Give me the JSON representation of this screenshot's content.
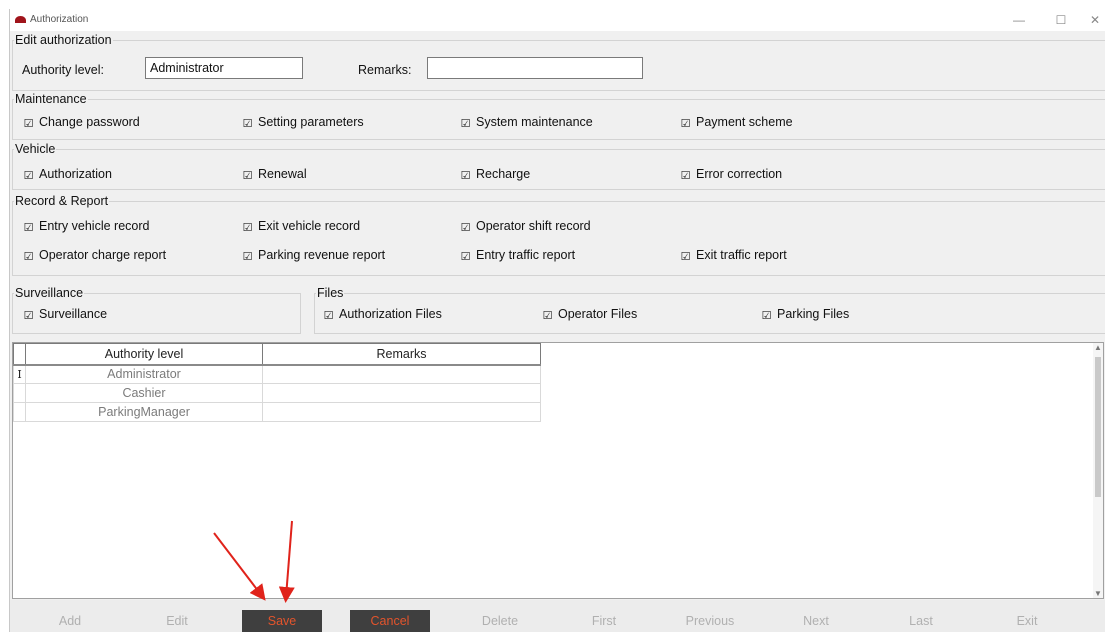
{
  "window": {
    "title": "Authorization",
    "controls": {
      "minimize": "—",
      "maximize": "☐",
      "close": "✕"
    }
  },
  "edit_authorization": {
    "legend": "Edit authorization",
    "authority_level_label": "Authority level:",
    "authority_level_value": "Administrator",
    "remarks_label": "Remarks:",
    "remarks_value": ""
  },
  "maintenance": {
    "legend": "Maintenance",
    "items": [
      {
        "label": "Change password",
        "checked": true
      },
      {
        "label": "Setting parameters",
        "checked": true
      },
      {
        "label": "System maintenance",
        "checked": true
      },
      {
        "label": "Payment scheme",
        "checked": true
      }
    ]
  },
  "vehicle": {
    "legend": "Vehicle",
    "items": [
      {
        "label": "Authorization",
        "checked": true
      },
      {
        "label": "Renewal",
        "checked": true
      },
      {
        "label": "Recharge",
        "checked": true
      },
      {
        "label": "Error correction",
        "checked": true
      }
    ]
  },
  "record_report": {
    "legend": "Record & Report",
    "items": [
      {
        "label": "Entry vehicle record",
        "checked": true
      },
      {
        "label": "Exit vehicle record",
        "checked": true
      },
      {
        "label": "Operator shift record",
        "checked": true
      },
      {
        "label": "Operator charge report",
        "checked": true
      },
      {
        "label": "Parking revenue report",
        "checked": true
      },
      {
        "label": "Entry traffic report",
        "checked": true
      },
      {
        "label": "Exit traffic report",
        "checked": true
      }
    ]
  },
  "surveillance": {
    "legend": "Surveillance",
    "items": [
      {
        "label": "Surveillance",
        "checked": true
      }
    ]
  },
  "files": {
    "legend": "Files",
    "items": [
      {
        "label": "Authorization Files",
        "checked": true
      },
      {
        "label": "Operator Files",
        "checked": true
      },
      {
        "label": "Parking Files",
        "checked": true
      }
    ]
  },
  "checkmark_glyph": "☑",
  "grid": {
    "columns": [
      "Authority level",
      "Remarks"
    ],
    "current_row_marker": "I",
    "rows": [
      {
        "level": "Administrator",
        "remarks": ""
      },
      {
        "level": "Cashier",
        "remarks": ""
      },
      {
        "level": "ParkingManager",
        "remarks": ""
      }
    ]
  },
  "toolbar": {
    "buttons": [
      "Add",
      "Edit",
      "Save",
      "Cancel",
      "Delete",
      "First",
      "Previous",
      "Next",
      "Last",
      "Exit"
    ]
  },
  "colors": {
    "active_button_bg": "#3f3f3f",
    "active_button_text": "#e3542c",
    "disabled_button_text": "#b0b0b0",
    "annotation_arrow": "#e0231b"
  }
}
